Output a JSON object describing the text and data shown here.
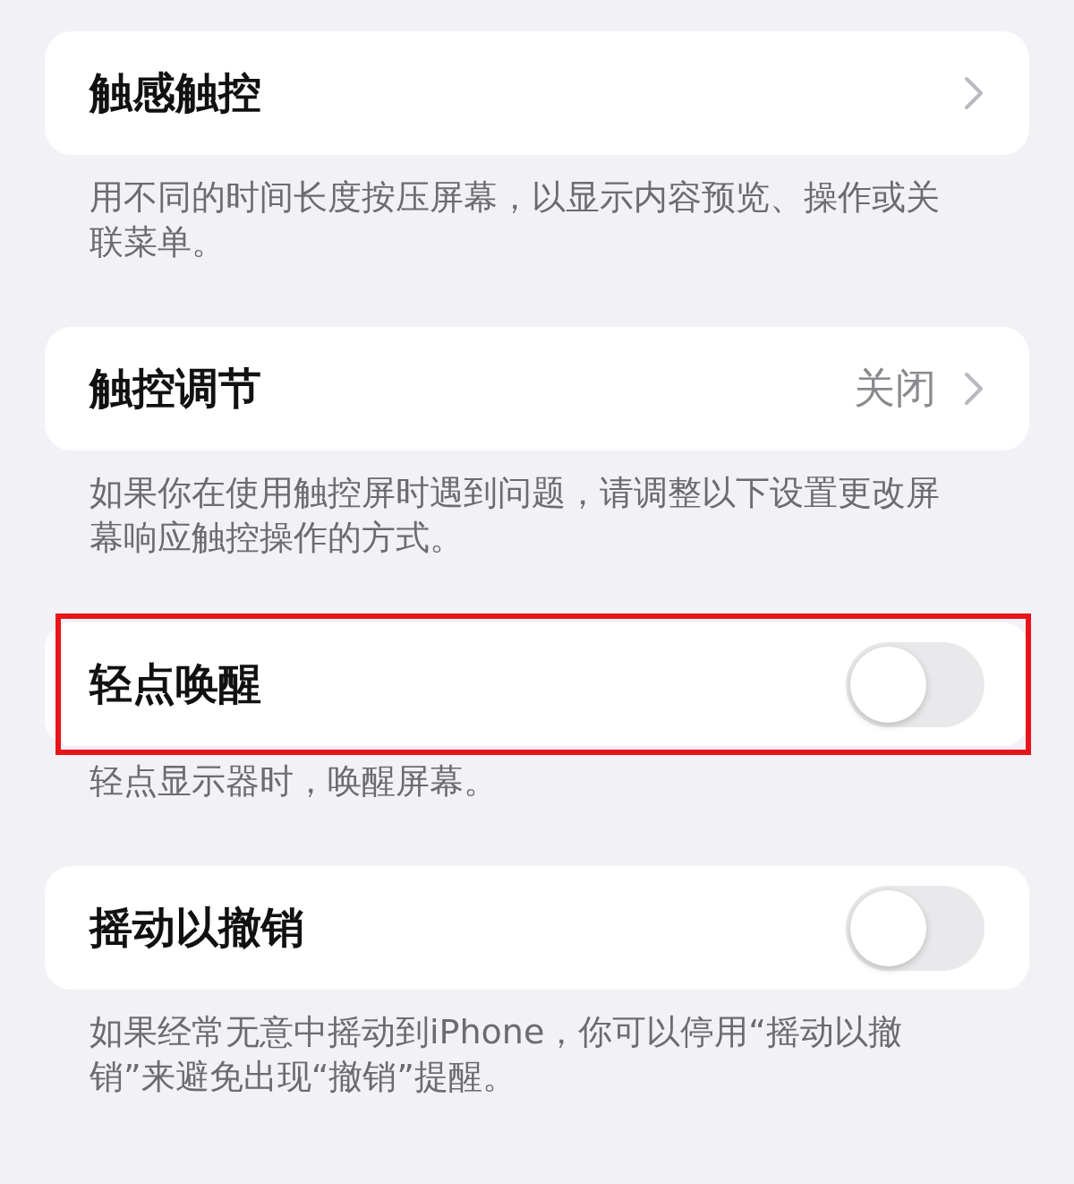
{
  "sections": [
    {
      "row": {
        "kind": "link",
        "label": "触感触控",
        "highlighted": false
      },
      "footer": "用不同的时间长度按压屏幕，以显示内容预览、操作或关联菜单。"
    },
    {
      "row": {
        "kind": "link",
        "label": "触控调节",
        "value": "关闭",
        "highlighted": false
      },
      "footer": "如果你在使用触控屏时遇到问题，请调整以下设置更改屏幕响应触控操作的方式。"
    },
    {
      "row": {
        "kind": "toggle",
        "label": "轻点唤醒",
        "on": false,
        "highlighted": true
      },
      "footer": "轻点显示器时，唤醒屏幕。"
    },
    {
      "row": {
        "kind": "toggle",
        "label": "摇动以撤销",
        "on": false,
        "highlighted": false
      },
      "footer": "如果经常无意中摇动到iPhone，你可以停用“摇动以撤销”来避免出现“撤销”提醒。"
    }
  ]
}
